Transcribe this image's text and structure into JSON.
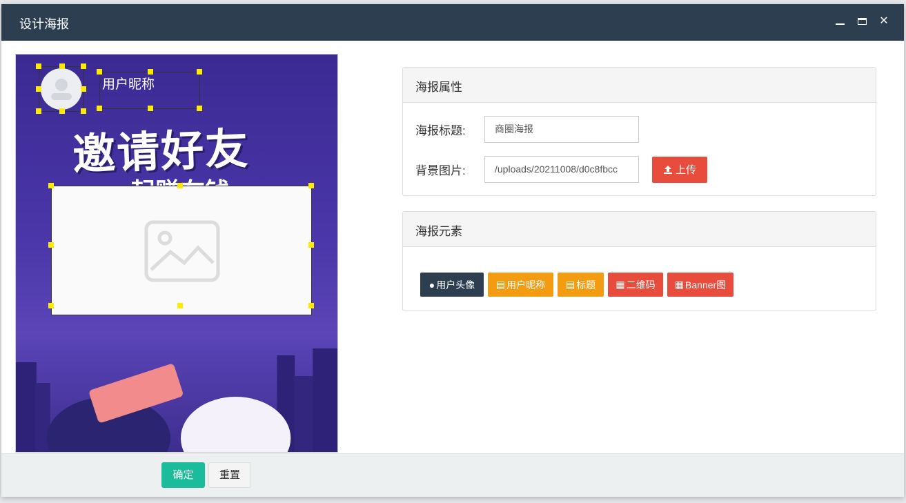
{
  "window": {
    "title": "设计海报"
  },
  "canvas": {
    "headline": "邀请好友",
    "subline": "一起赚在钱",
    "nickname": "用户昵称"
  },
  "props_panel": {
    "title": "海报属性",
    "poster_title_label": "海报标题:",
    "poster_title_value": "商圈海报",
    "bg_label": "背景图片:",
    "bg_value": "/uploads/20211008/d0c8fbcc",
    "upload_label": "上传"
  },
  "elements_panel": {
    "title": "海报元素",
    "buttons": [
      {
        "label": "用户头像",
        "icon": "user-icon",
        "color": "#2c3e50"
      },
      {
        "label": "用户昵称",
        "icon": "file-icon",
        "color": "#f39c12"
      },
      {
        "label": "标题",
        "icon": "file-icon",
        "color": "#f39c12"
      },
      {
        "label": "二维码",
        "icon": "qrcode-icon",
        "color": "#e74c3c"
      },
      {
        "label": "Banner图",
        "icon": "qrcode-icon",
        "color": "#e74c3c"
      }
    ]
  },
  "footer": {
    "ok_label": "确定",
    "reset_label": "重置"
  }
}
